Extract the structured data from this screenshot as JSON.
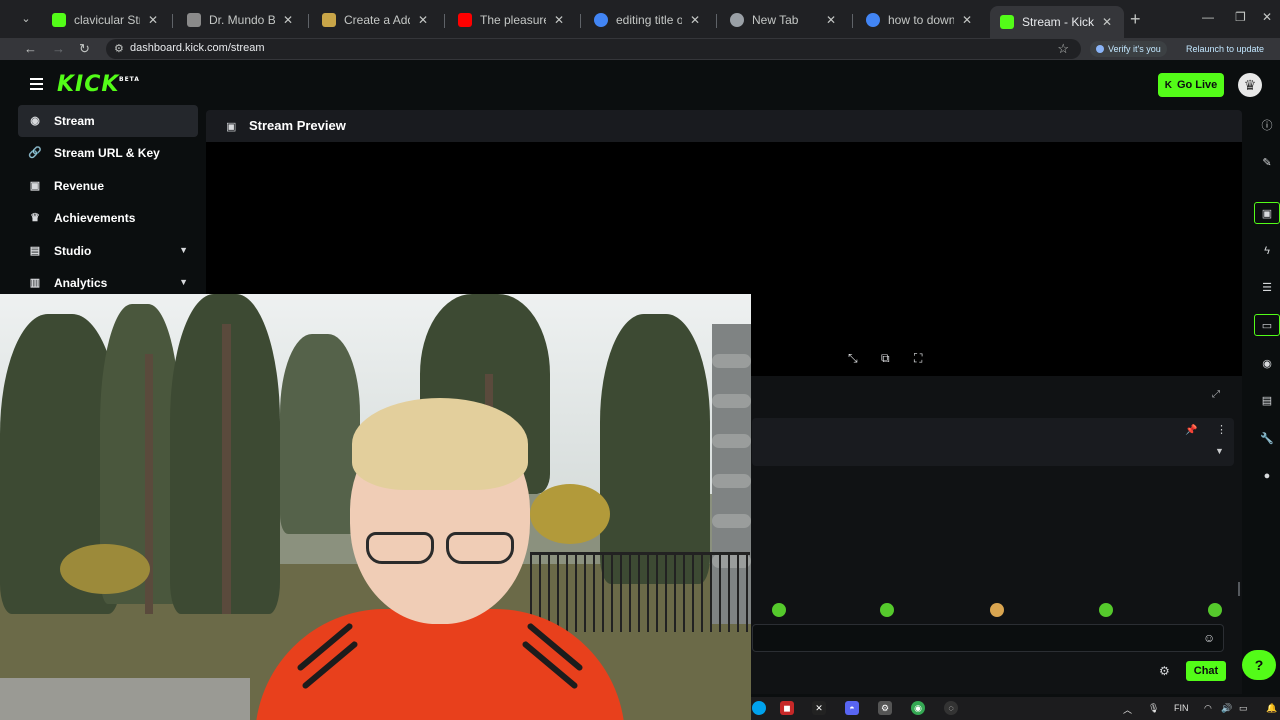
{
  "browser": {
    "tabs": [
      {
        "title": "clavicular Stream - W",
        "favicon_color": "#53fc18",
        "active": false
      },
      {
        "title": "Dr. Mundo Build - Le",
        "favicon_color": "#8a8a8a",
        "active": false
      },
      {
        "title": "Create a Addiction T",
        "favicon_color": "#c8a548",
        "active": false
      },
      {
        "title": "The pleasure trap: D",
        "favicon_color": "#ff0000",
        "active": false
      },
      {
        "title": "editing title on kick s",
        "favicon_color": "#4285f4",
        "active": false
      },
      {
        "title": "New Tab",
        "favicon_color": "#9aa0a6",
        "active": false
      },
      {
        "title": "how to download m",
        "favicon_color": "#4285f4",
        "active": false
      },
      {
        "title": "Stream - Kick Dashb",
        "favicon_color": "#53fc18",
        "active": true
      }
    ],
    "new_tab": "+",
    "url": "dashboard.kick.com/stream",
    "verify_label": "Verify it's you",
    "relaunch_label": "Relaunch to update"
  },
  "header": {
    "logo": "KICK",
    "logo_badge": "BETA",
    "go_live_label": "Go Live"
  },
  "sidebar": {
    "items": [
      {
        "label": "Stream",
        "icon": "eye-icon",
        "active": true,
        "expandable": false
      },
      {
        "label": "Stream URL & Key",
        "icon": "link-icon",
        "active": false,
        "expandable": false
      },
      {
        "label": "Revenue",
        "icon": "money-icon",
        "active": false,
        "expandable": false
      },
      {
        "label": "Achievements",
        "icon": "trophy-icon",
        "active": false,
        "expandable": false
      },
      {
        "label": "Studio",
        "icon": "studio-icon",
        "active": false,
        "expandable": true
      },
      {
        "label": "Analytics",
        "icon": "chart-icon",
        "active": false,
        "expandable": true
      }
    ]
  },
  "preview": {
    "title": "Stream Preview"
  },
  "chat": {
    "send_label": "Chat"
  },
  "taskbar": {
    "language": "FIN"
  },
  "colors": {
    "accent": "#53fc18",
    "background": "#0b0e0f",
    "panel": "#191b1f"
  }
}
